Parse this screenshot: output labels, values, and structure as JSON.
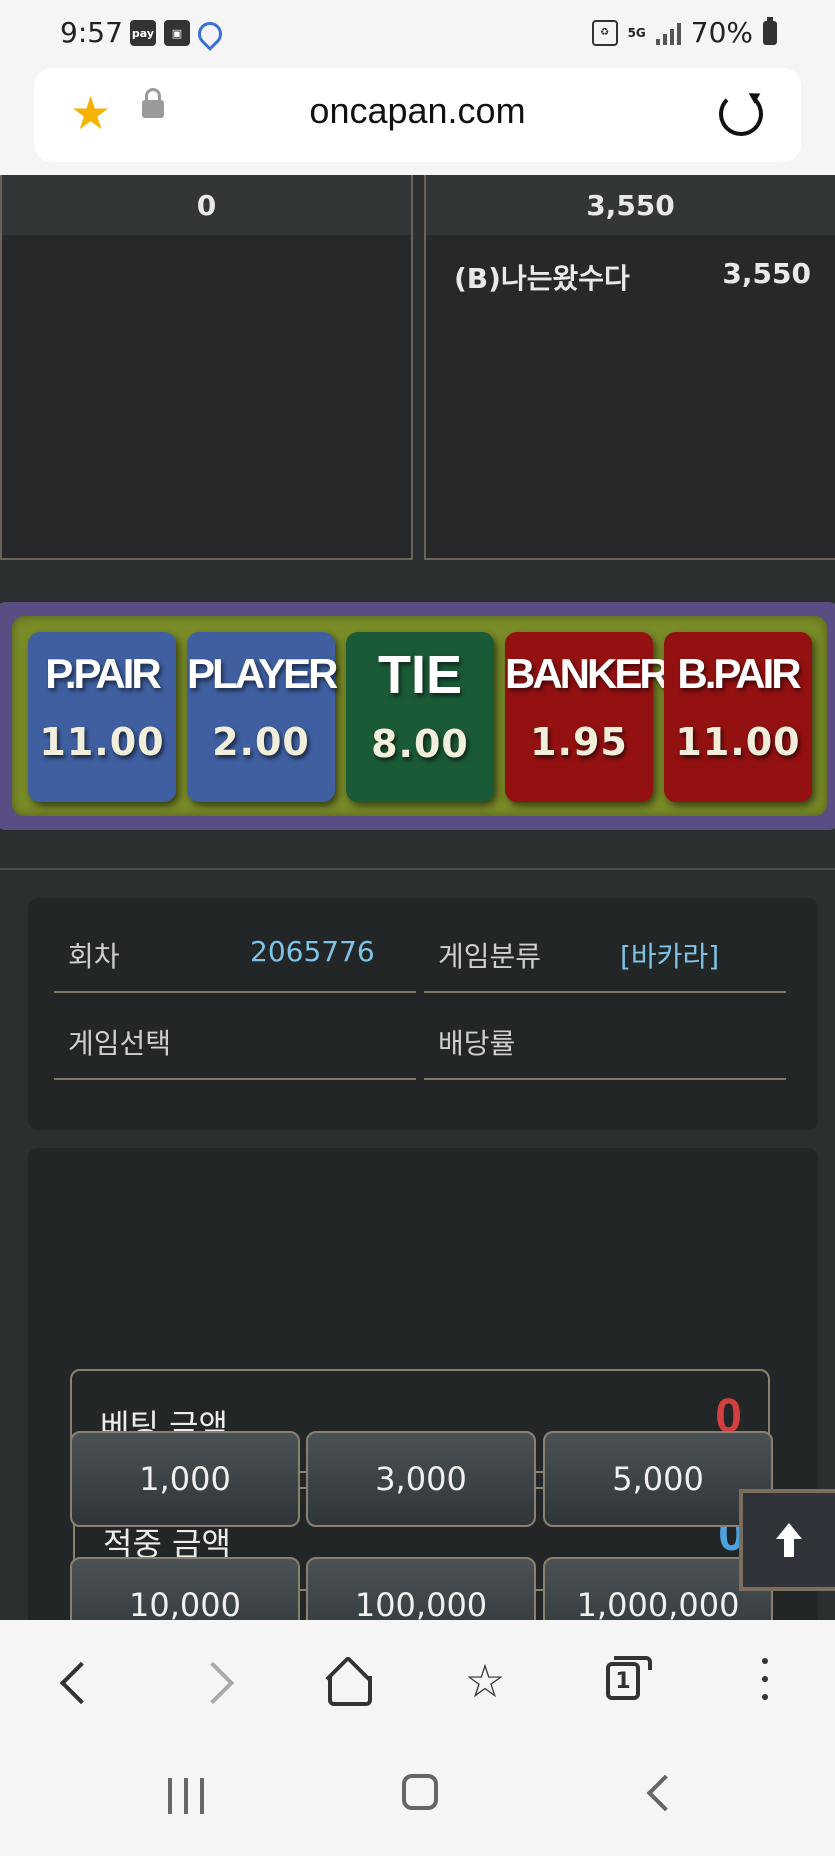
{
  "status_bar": {
    "time": "9:57",
    "left_icons": [
      "pay-icon",
      "gallery-icon",
      "map-pin-icon"
    ],
    "pay_label": "pay",
    "network": "5G",
    "battery": "70%"
  },
  "browser": {
    "url": "oncapan.com",
    "tab_count": "1"
  },
  "totals": {
    "left_total": "0",
    "right_total": "3,550",
    "bettors": [
      {
        "name": "(B)나는왔수다",
        "amount": "3,550"
      }
    ]
  },
  "odds": [
    {
      "name": "P.PAIR",
      "value": "11.00",
      "color": "#3f5fa0"
    },
    {
      "name": "PLAYER",
      "value": "2.00",
      "color": "#3f5fa0"
    },
    {
      "name": "TIE",
      "value": "8.00",
      "color": "#1b5a37"
    },
    {
      "name": "BANKER",
      "value": "1.95",
      "color": "#931111"
    },
    {
      "name": "B.PAIR",
      "value": "11.00",
      "color": "#931111"
    }
  ],
  "info": {
    "round_label": "회차",
    "round_value": "2065776",
    "category_label": "게임분류",
    "category_value": "[바카라]",
    "selection_label": "게임선택",
    "selection_value": "",
    "odds_label": "배당률",
    "odds_value": ""
  },
  "bet": {
    "bet_amount_label": "베팅 금액",
    "bet_amount_value": "0",
    "win_amount_label": "적중 금액",
    "win_amount_value": "0",
    "chips": [
      "1,000",
      "3,000",
      "5,000",
      "10,000",
      "100,000",
      "1,000,000"
    ]
  },
  "colors": {
    "accent_value": "#7ec3e6",
    "bet_amount": "#d23f3f",
    "win_amount": "#4da3e0",
    "frame_purple": "#5a4d83",
    "frame_green": "#7a8c28"
  }
}
